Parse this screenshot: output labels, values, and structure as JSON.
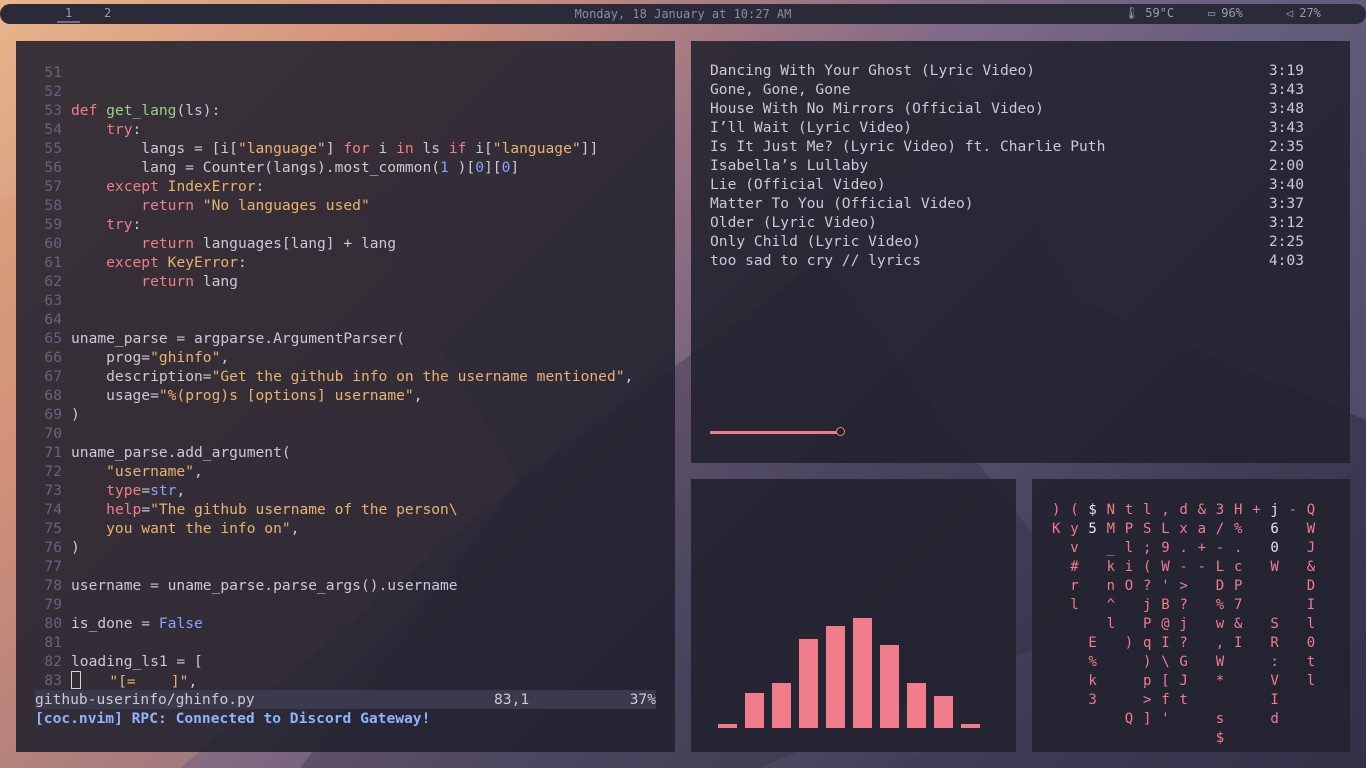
{
  "topbar": {
    "workspaces": [
      "1",
      "2"
    ],
    "active_workspace": "1",
    "clock": "Monday, 18 January at 10:27 AM",
    "temperature": "59°C",
    "battery": "96%",
    "volume": "27%",
    "icons": [
      "thermometer-icon",
      "battery-icon",
      "speaker-icon"
    ]
  },
  "editor": {
    "lines": [
      {
        "n": "51",
        "parts": []
      },
      {
        "n": "52",
        "parts": []
      },
      {
        "n": "53",
        "parts": [
          [
            "kw",
            "def "
          ],
          [
            "fn",
            "get_lang"
          ],
          [
            "",
            "(ls):"
          ]
        ]
      },
      {
        "n": "54",
        "parts": [
          [
            "kw",
            "    try"
          ],
          [
            "",
            ":"
          ]
        ]
      },
      {
        "n": "55",
        "parts": [
          [
            "",
            "        langs = [i["
          ],
          [
            "str",
            "\"language\""
          ],
          [
            "",
            "] "
          ],
          [
            "kw",
            "for"
          ],
          [
            "",
            " i "
          ],
          [
            "kw",
            "in"
          ],
          [
            "",
            " ls "
          ],
          [
            "kw",
            "if"
          ],
          [
            "",
            " i["
          ],
          [
            "str",
            "\"language\""
          ],
          [
            "",
            "]]"
          ]
        ]
      },
      {
        "n": "56",
        "parts": [
          [
            "",
            "        lang = Counter(langs).most_common("
          ],
          [
            "typ",
            "1"
          ],
          [
            "",
            " )["
          ],
          [
            "typ",
            "0"
          ],
          [
            "",
            "]["
          ],
          [
            "typ",
            "0"
          ],
          [
            "",
            "]"
          ]
        ]
      },
      {
        "n": "57",
        "parts": [
          [
            "kw",
            "    except "
          ],
          [
            "cls",
            "IndexError"
          ],
          [
            "",
            ":"
          ]
        ]
      },
      {
        "n": "58",
        "parts": [
          [
            "kw",
            "        return "
          ],
          [
            "str",
            "\"No languages used\""
          ]
        ]
      },
      {
        "n": "59",
        "parts": [
          [
            "kw",
            "    try"
          ],
          [
            "",
            ":"
          ]
        ]
      },
      {
        "n": "60",
        "parts": [
          [
            "kw",
            "        return "
          ],
          [
            "",
            "languages[lang] + lang"
          ]
        ]
      },
      {
        "n": "61",
        "parts": [
          [
            "kw",
            "    except "
          ],
          [
            "cls",
            "KeyError"
          ],
          [
            "",
            ":"
          ]
        ]
      },
      {
        "n": "62",
        "parts": [
          [
            "kw",
            "        return "
          ],
          [
            "",
            "lang"
          ]
        ]
      },
      {
        "n": "63",
        "parts": []
      },
      {
        "n": "64",
        "parts": []
      },
      {
        "n": "65",
        "parts": [
          [
            "",
            "uname_parse = argparse.ArgumentParser("
          ]
        ]
      },
      {
        "n": "66",
        "parts": [
          [
            "",
            "    prog="
          ],
          [
            "str",
            "\"ghinfo\""
          ],
          [
            "",
            ","
          ]
        ]
      },
      {
        "n": "67",
        "parts": [
          [
            "",
            "    description="
          ],
          [
            "str",
            "\"Get the github info on the username mentioned\""
          ],
          [
            "",
            ","
          ]
        ]
      },
      {
        "n": "68",
        "parts": [
          [
            "",
            "    usage="
          ],
          [
            "str",
            "\"%(prog)s [options] username\""
          ],
          [
            "",
            ","
          ]
        ]
      },
      {
        "n": "69",
        "parts": [
          [
            "",
            ")"
          ]
        ]
      },
      {
        "n": "70",
        "parts": []
      },
      {
        "n": "71",
        "parts": [
          [
            "",
            "uname_parse.add_argument("
          ]
        ]
      },
      {
        "n": "72",
        "parts": [
          [
            "str",
            "    \"username\""
          ],
          [
            "",
            ","
          ]
        ]
      },
      {
        "n": "73",
        "parts": [
          [
            "",
            "    "
          ],
          [
            "kw",
            "type"
          ],
          [
            "",
            "="
          ],
          [
            "typ",
            "str"
          ],
          [
            "",
            ","
          ]
        ]
      },
      {
        "n": "74",
        "parts": [
          [
            "",
            "    "
          ],
          [
            "kw",
            "help"
          ],
          [
            "",
            "="
          ],
          [
            "str",
            "\"The github username of the person\\"
          ]
        ]
      },
      {
        "n": "75",
        "parts": [
          [
            "str",
            "    you want the info on\""
          ],
          [
            "",
            ","
          ]
        ]
      },
      {
        "n": "76",
        "parts": [
          [
            "",
            ")"
          ]
        ]
      },
      {
        "n": "77",
        "parts": []
      },
      {
        "n": "78",
        "parts": [
          [
            "",
            "username = uname_parse.parse_args().username"
          ]
        ]
      },
      {
        "n": "79",
        "parts": []
      },
      {
        "n": "80",
        "parts": [
          [
            "",
            "is_done = "
          ],
          [
            "typ",
            "False"
          ]
        ]
      },
      {
        "n": "81",
        "parts": []
      },
      {
        "n": "82",
        "parts": [
          [
            "",
            "loading_ls1 = ["
          ]
        ]
      },
      {
        "n": "83",
        "parts": [
          [
            "cursor",
            ""
          ],
          [
            "",
            "   "
          ],
          [
            "str",
            "\"[=    ]\""
          ],
          [
            "",
            ","
          ]
        ]
      }
    ],
    "statusline": {
      "file": "github-userinfo/ghinfo.py",
      "position": "83,1",
      "percent": "37%"
    },
    "message": "[coc.nvim] RPC: Connected to Discord Gateway!"
  },
  "music": {
    "tracks": [
      {
        "title": "Dancing With Your Ghost (Lyric Video)",
        "duration": "3:19"
      },
      {
        "title": "Gone, Gone, Gone",
        "duration": "3:43"
      },
      {
        "title": "House With No Mirrors (Official Video)",
        "duration": "3:48"
      },
      {
        "title": "I’ll Wait (Lyric Video)",
        "duration": "3:43"
      },
      {
        "title": "Is It Just Me? (Lyric Video) ft. Charlie Puth",
        "duration": "2:35"
      },
      {
        "title": "Isabella’s Lullaby",
        "duration": "2:00"
      },
      {
        "title": "Lie (Official Video)",
        "duration": "3:40"
      },
      {
        "title": "Matter To You (Official Video)",
        "duration": "3:37"
      },
      {
        "title": "Older (Lyric Video)",
        "duration": "3:12"
      },
      {
        "title": "Only Child (Lyric Video)",
        "duration": "2:25"
      },
      {
        "title": "too sad to cry // lyrics",
        "duration": "4:03"
      }
    ],
    "progress": 0.2,
    "accent": "#f07c8c"
  },
  "visualizer": {
    "levels": [
      0.02,
      0.32,
      0.41,
      0.81,
      0.93,
      1.0,
      0.75,
      0.41,
      0.29,
      0.03
    ]
  },
  "matrix": {
    "columns": [
      {
        "chars": ") K"
      },
      {
        "chars": "( y v # r l"
      },
      {
        "chars": "$ 5      E % k 3"
      },
      {
        "chars": "N M _ k n ^ l"
      },
      {
        "chars": "t P l i O   )    Q"
      },
      {
        "chars": "l S ; ( ? j P q ) p > ]"
      },
      {
        "chars": ", L 9 W ' B @ I \\ [ f '"
      },
      {
        "chars": "d x . - > ? j ? G J t"
      },
      {
        "chars": "& a + -"
      },
      {
        "chars": "3 / - L D % w , W *  s $"
      },
      {
        "chars": "H % . c P 7 & I"
      },
      {
        "chars": "+"
      },
      {
        "chars": "j 6 0 W   S R : V I d"
      },
      {
        "chars": "-"
      },
      {
        "chars": "Q W J & D I l 0 t l"
      }
    ]
  }
}
